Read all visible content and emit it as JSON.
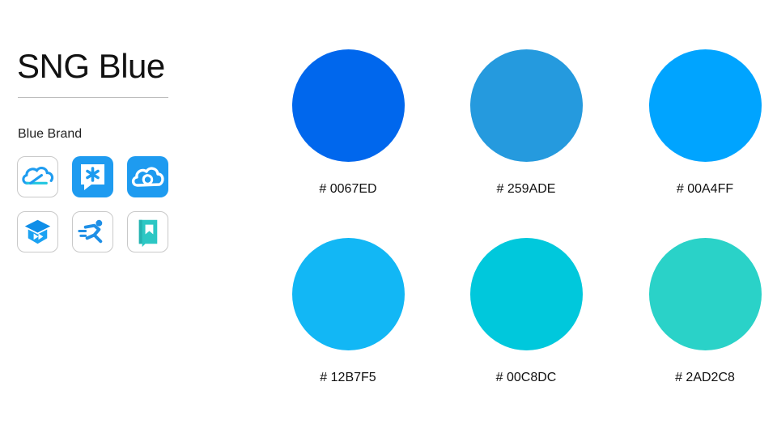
{
  "title": "SNG Blue",
  "section_label": "Blue Brand",
  "brand_icons": [
    {
      "name": "tencent-cloud-icon",
      "style": "outline"
    },
    {
      "name": "qq-chat-asterisk-icon",
      "style": "filled"
    },
    {
      "name": "weiyun-cloud-icon",
      "style": "filled"
    },
    {
      "name": "tencent-classroom-icon",
      "style": "outline"
    },
    {
      "name": "qq-sports-runner-icon",
      "style": "outline"
    },
    {
      "name": "qq-reading-book-icon",
      "style": "outline"
    }
  ],
  "swatches": [
    {
      "label": "# 0067ED",
      "color": "#0067ED"
    },
    {
      "label": "# 259ADE",
      "color": "#259ADE"
    },
    {
      "label": "# 00A4FF",
      "color": "#00A4FF"
    },
    {
      "label": "# 12B7F5",
      "color": "#12B7F5"
    },
    {
      "label": "# 00C8DC",
      "color": "#00C8DC"
    },
    {
      "label": "# 2AD2C8",
      "color": "#2AD2C8"
    }
  ]
}
